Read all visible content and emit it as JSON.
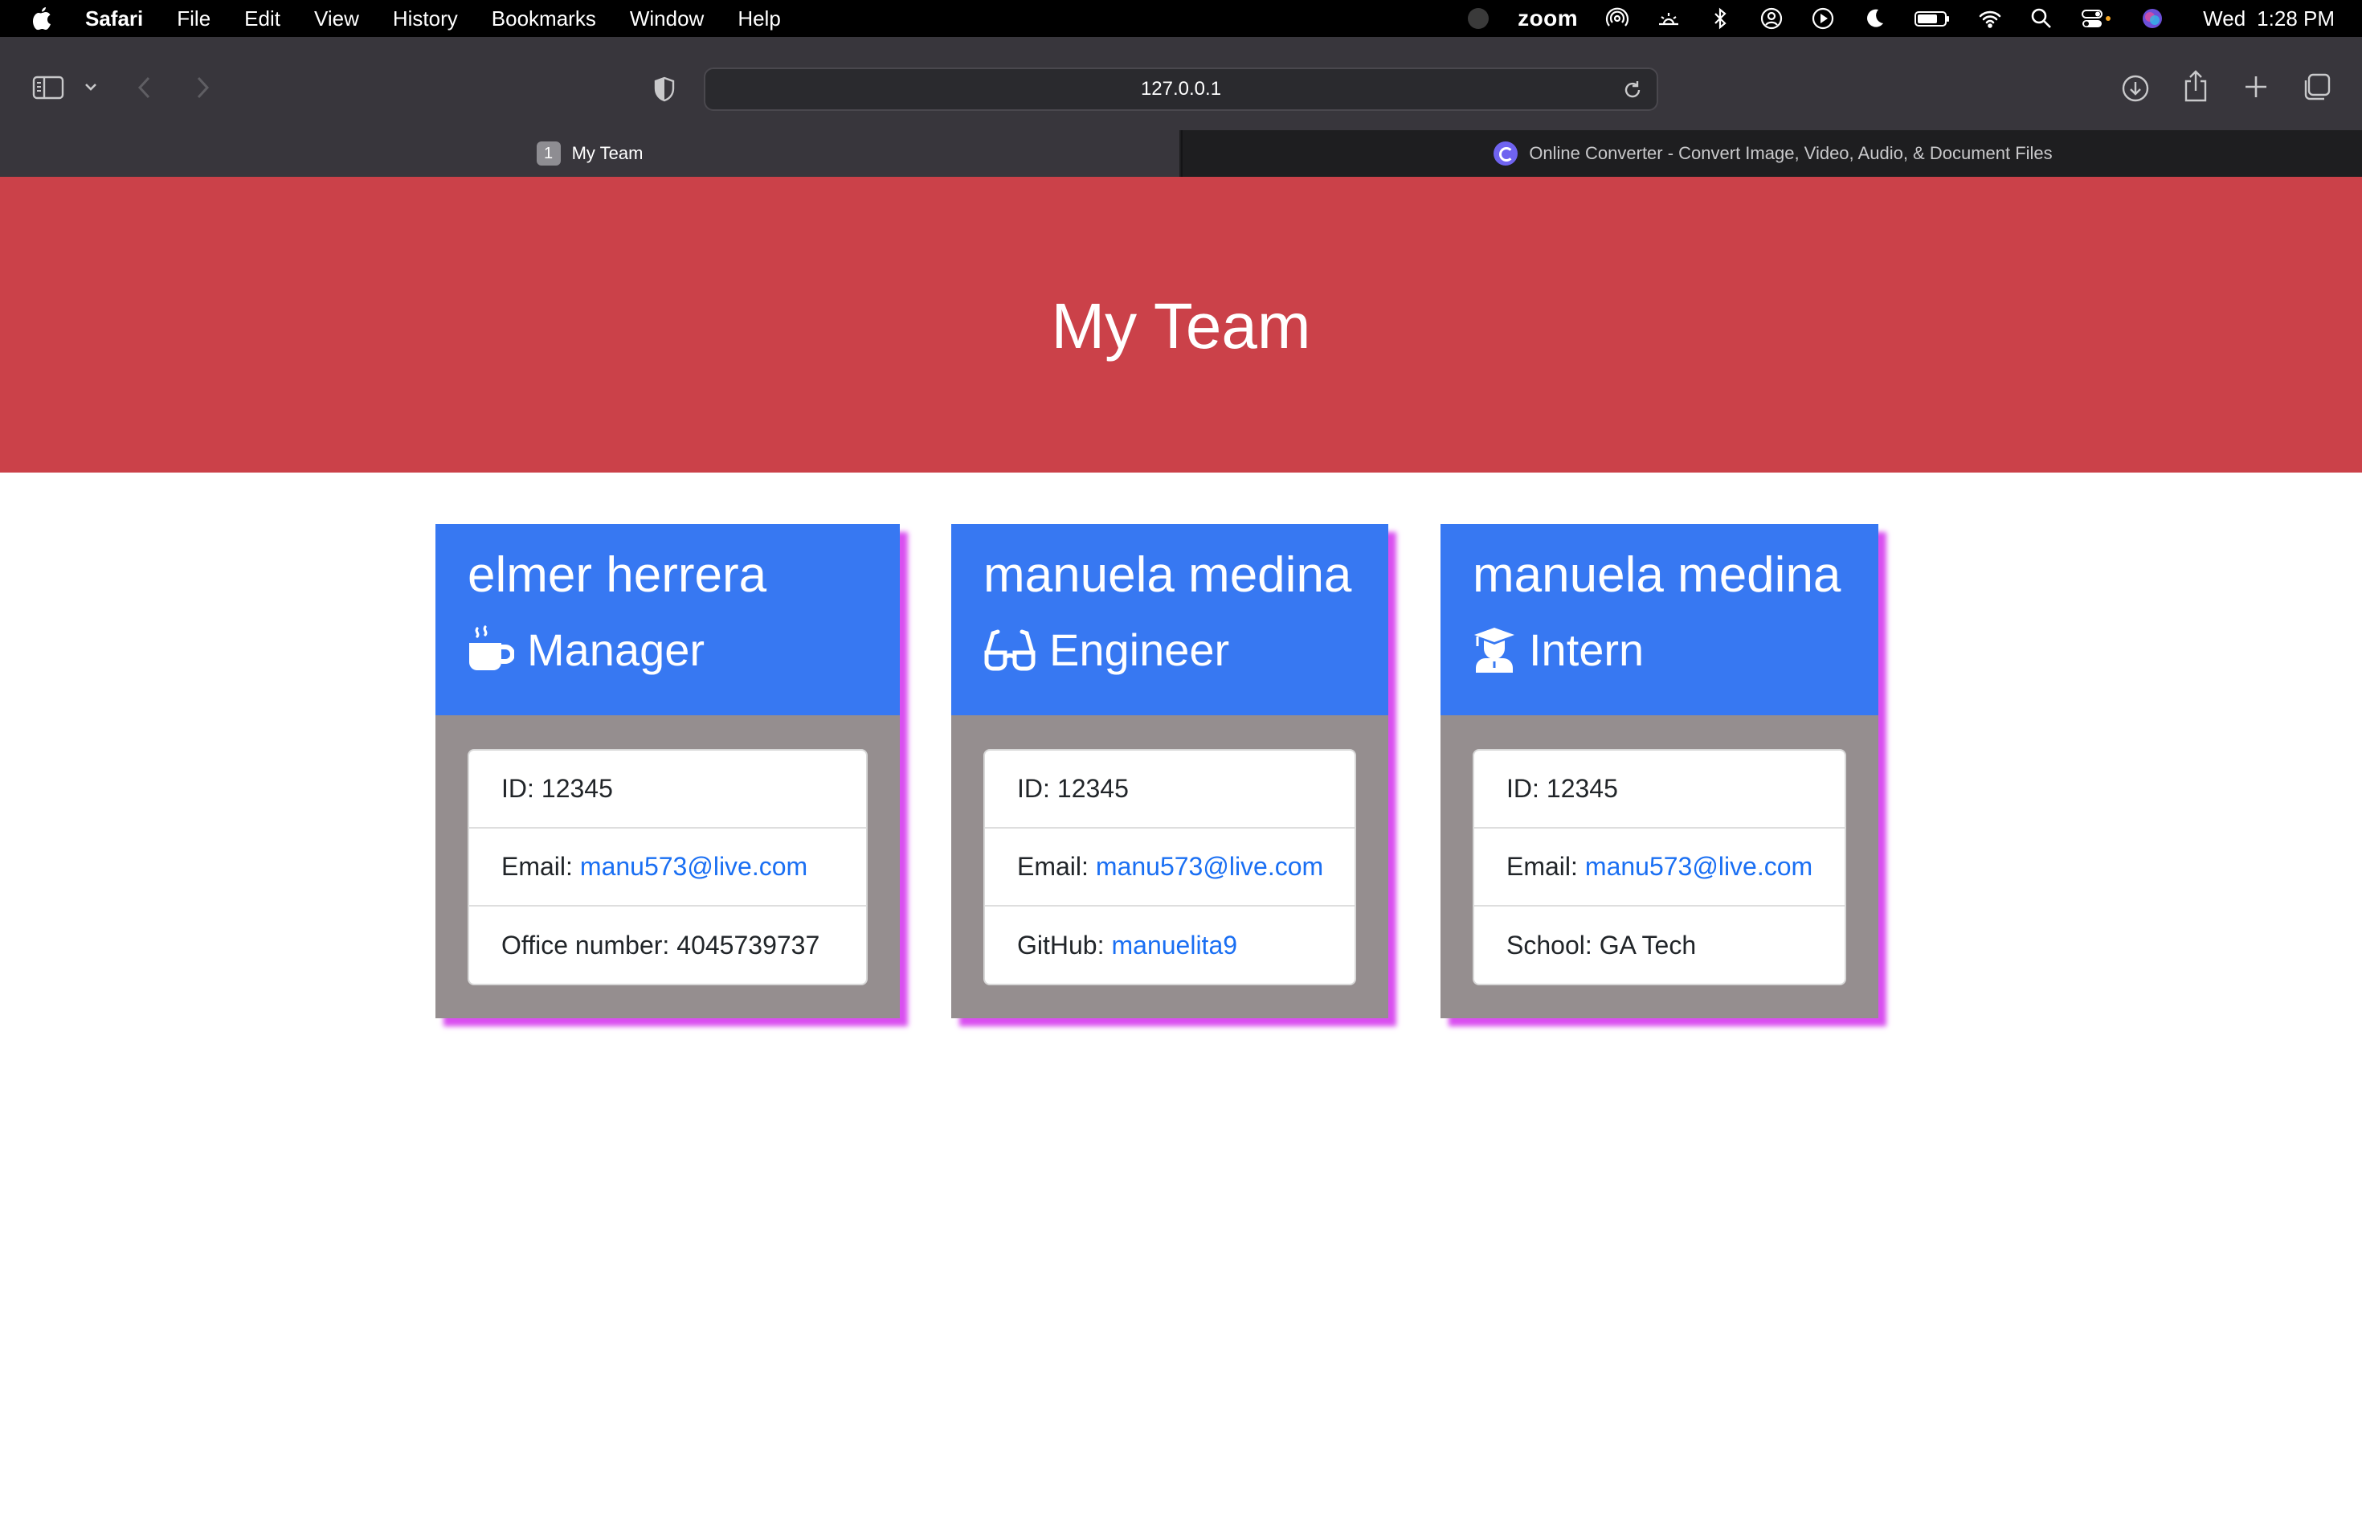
{
  "menubar": {
    "app_name": "Safari",
    "menus": [
      "File",
      "Edit",
      "View",
      "History",
      "Bookmarks",
      "Window",
      "Help"
    ],
    "zoom_label": "zoom",
    "day": "Wed",
    "time": "1:28 PM"
  },
  "browser": {
    "url": "127.0.0.1",
    "tabs": [
      {
        "badge": "1",
        "title": "My Team"
      },
      {
        "title": "Online Converter - Convert Image, Video, Audio, & Document Files"
      }
    ]
  },
  "page": {
    "title": "My Team",
    "cards": [
      {
        "name": "elmer herrera",
        "role": "Manager",
        "role_icon": "mug-hot-icon",
        "id_label": "ID:",
        "id": "12345",
        "email_label": "Email:",
        "email": "manu573@live.com",
        "extra_label": "Office number:",
        "extra": "4045739737"
      },
      {
        "name": "manuela medina",
        "role": "Engineer",
        "role_icon": "glasses-icon",
        "id_label": "ID:",
        "id": "12345",
        "email_label": "Email:",
        "email": "manu573@live.com",
        "extra_label": "GitHub:",
        "extra": "manuelita9"
      },
      {
        "name": "manuela medina",
        "role": "Intern",
        "role_icon": "graduate-icon",
        "id_label": "ID:",
        "id": "12345",
        "email_label": "Email:",
        "email": "manu573@live.com",
        "extra_label": "School:",
        "extra": "GA Tech"
      }
    ]
  },
  "colors": {
    "hero": "#cb4149",
    "card_header": "#3778f2",
    "card_body": "#958e8f",
    "card_shadow": "#d94ff0",
    "link": "#1a6ff3"
  }
}
